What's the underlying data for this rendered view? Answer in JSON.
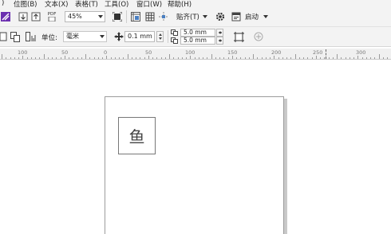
{
  "menu": {
    "items": [
      {
        "label": ")"
      },
      {
        "label": "位图(B)"
      },
      {
        "label": "文本(X)"
      },
      {
        "label": "表格(T)"
      },
      {
        "label": "工具(O)"
      },
      {
        "label": "窗口(W)"
      },
      {
        "label": "帮助(H)"
      }
    ]
  },
  "toolbar1": {
    "pdf_label": "PDF",
    "zoom_value": "45%",
    "snap_label": "贴齐(T)",
    "launch_label": "启动"
  },
  "toolbar2": {
    "units_label": "单位:",
    "units_value": "毫米",
    "nudge_value": "0.1 mm",
    "dup_x_value": "5.0 mm",
    "dup_y_value": "5.0 mm"
  },
  "ruler": {
    "labels": [
      "100",
      "50",
      "0",
      "50",
      "100",
      "150",
      "200",
      "250",
      "300"
    ]
  },
  "canvas": {
    "character": "鱼"
  },
  "colors": {
    "toolbar_bg": "#f3f3f3",
    "accent_purple": "#6b2fb0"
  }
}
